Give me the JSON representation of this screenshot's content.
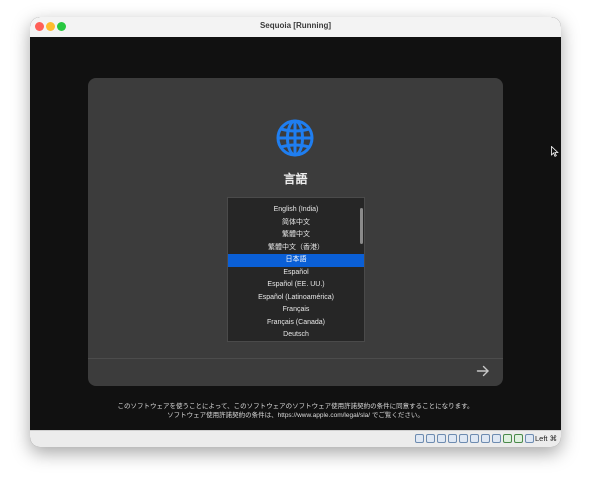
{
  "window": {
    "title": "Sequoia [Running]"
  },
  "installer": {
    "heading": "言語",
    "icon": "globe-icon",
    "language_list": {
      "items": [
        "English (India)",
        "简体中文",
        "繁體中文",
        "繁體中文（香港）",
        "日本語",
        "Español",
        "Español (EE. UU.)",
        "Español (Latinoamérica)",
        "Français",
        "Français (Canada)",
        "Deutsch"
      ],
      "selected": "日本語"
    },
    "next_icon": "arrow-right-icon",
    "terms": {
      "line1": "このソフトウェアを使うことによって、このソフトウェアのソフトウェア使用許諾契約の条件に同意することになります。",
      "line2": "ソフトウェア使用許諾契約の条件は、https://www.apple.com/legal/sla/ でご覧ください。"
    }
  },
  "statusbar": {
    "host_key_label": "Left ⌘"
  },
  "colors": {
    "selection": "#0a5fd6",
    "globe": "#1f7ef0",
    "panel": "#3c3c3c"
  }
}
